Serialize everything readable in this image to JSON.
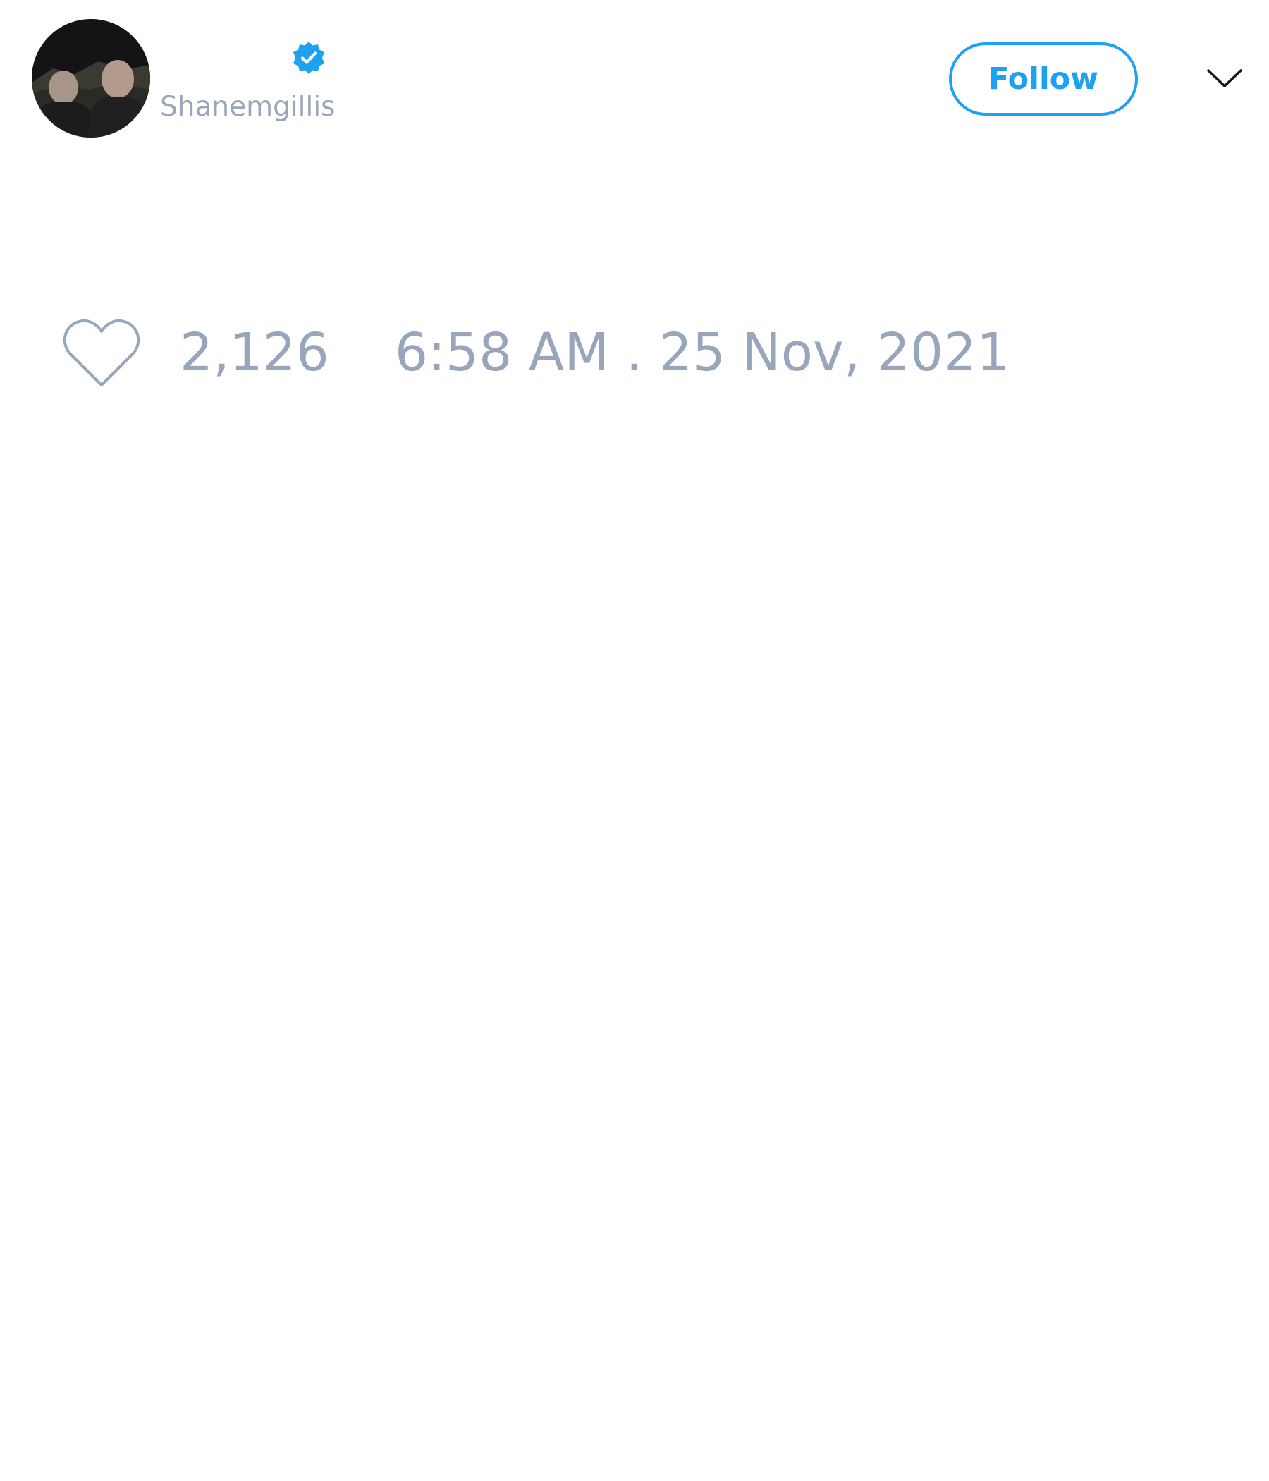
{
  "tweet": {
    "author": {
      "handle": "Shanemgillis",
      "verified": true,
      "avatar_icon": "profile-photo-two-people"
    },
    "follow_button_label": "Follow",
    "menu_icon": "chevron-down-icon",
    "likes": {
      "count": "2,126",
      "icon": "heart-icon"
    },
    "timestamp": "6:58 AM . 25 Nov, 2021"
  },
  "colors": {
    "accent": "#1da1f2",
    "muted_text": "#97a6bb",
    "background": "#ffffff"
  }
}
